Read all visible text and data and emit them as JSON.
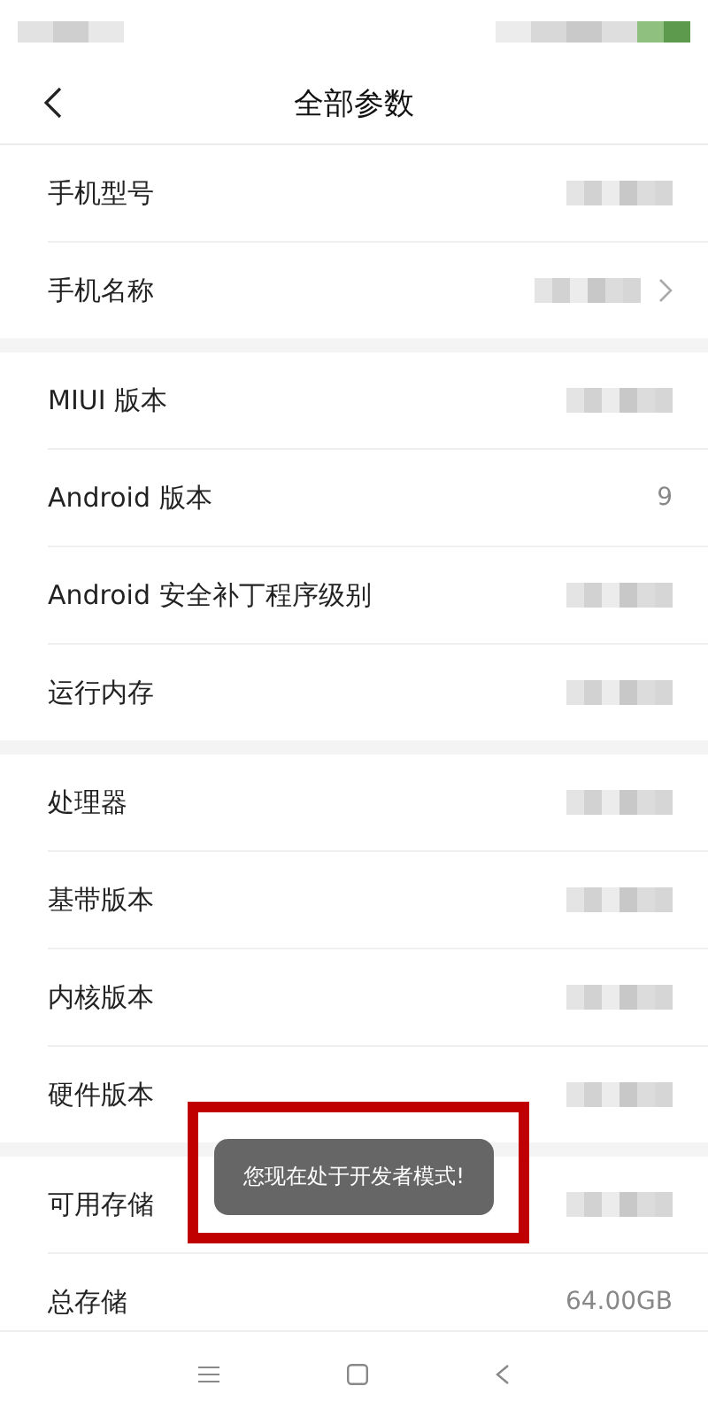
{
  "header": {
    "title": "全部参数"
  },
  "groups": [
    {
      "rows": [
        {
          "label": "手机型号",
          "kind": "pixelated",
          "chevron": false
        },
        {
          "label": "手机名称",
          "kind": "pixelated",
          "chevron": true
        }
      ]
    },
    {
      "rows": [
        {
          "label": "MIUI 版本",
          "kind": "pixelated"
        },
        {
          "label": "Android 版本",
          "kind": "text",
          "value": "9"
        },
        {
          "label": "Android 安全补丁程序级别",
          "kind": "pixelated"
        },
        {
          "label": "运行内存",
          "kind": "pixelated"
        }
      ]
    },
    {
      "rows": [
        {
          "label": "处理器",
          "kind": "pixelated"
        },
        {
          "label": "基带版本",
          "kind": "pixelated"
        },
        {
          "label": "内核版本",
          "kind": "pixelated"
        },
        {
          "label": "硬件版本",
          "kind": "pixelated"
        }
      ]
    },
    {
      "rows": [
        {
          "label": "可用存储",
          "kind": "pixelated"
        },
        {
          "label": "总存储",
          "kind": "text",
          "value": "64.00GB"
        }
      ]
    }
  ],
  "toast": {
    "text": "您现在处于开发者模式!",
    "highlighted": true
  }
}
